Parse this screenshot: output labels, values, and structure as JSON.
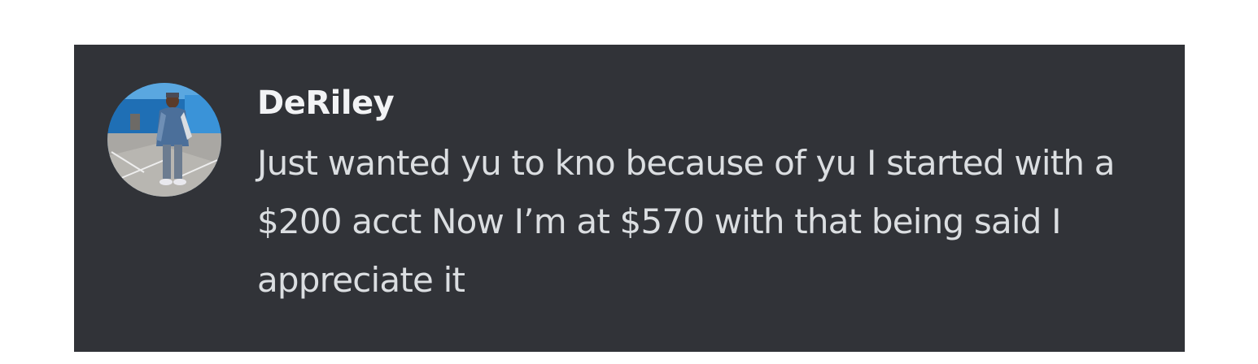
{
  "message": {
    "author": "DeRiley",
    "avatar_icon": "user-avatar-photo",
    "text": "Just wanted yu to kno because of yu I started with a $200 acct Now I’m at $570 with that being said I appreciate it"
  },
  "colors": {
    "card_background": "#313338",
    "username": "#f2f3f5",
    "message_text": "#dbdee1"
  }
}
